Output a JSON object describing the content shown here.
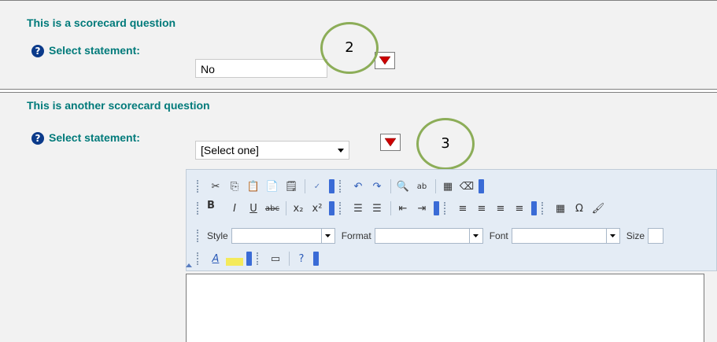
{
  "question1": {
    "title": "This is a scorecard question",
    "label": "Select statement:",
    "value": "No",
    "annotation": "2"
  },
  "question2": {
    "title": "This is another scorecard question",
    "label": "Select statement:",
    "select_value": "[Select one]",
    "annotation": "3"
  },
  "editor": {
    "style_label": "Style",
    "format_label": "Format",
    "font_label": "Font",
    "size_label": "Size"
  },
  "colors": {
    "heading": "#007a7a",
    "annotation_circle": "#8cad58",
    "dropdown_button_arrow": "#cc0000",
    "toolbar_bg": "#e4ecf5"
  }
}
